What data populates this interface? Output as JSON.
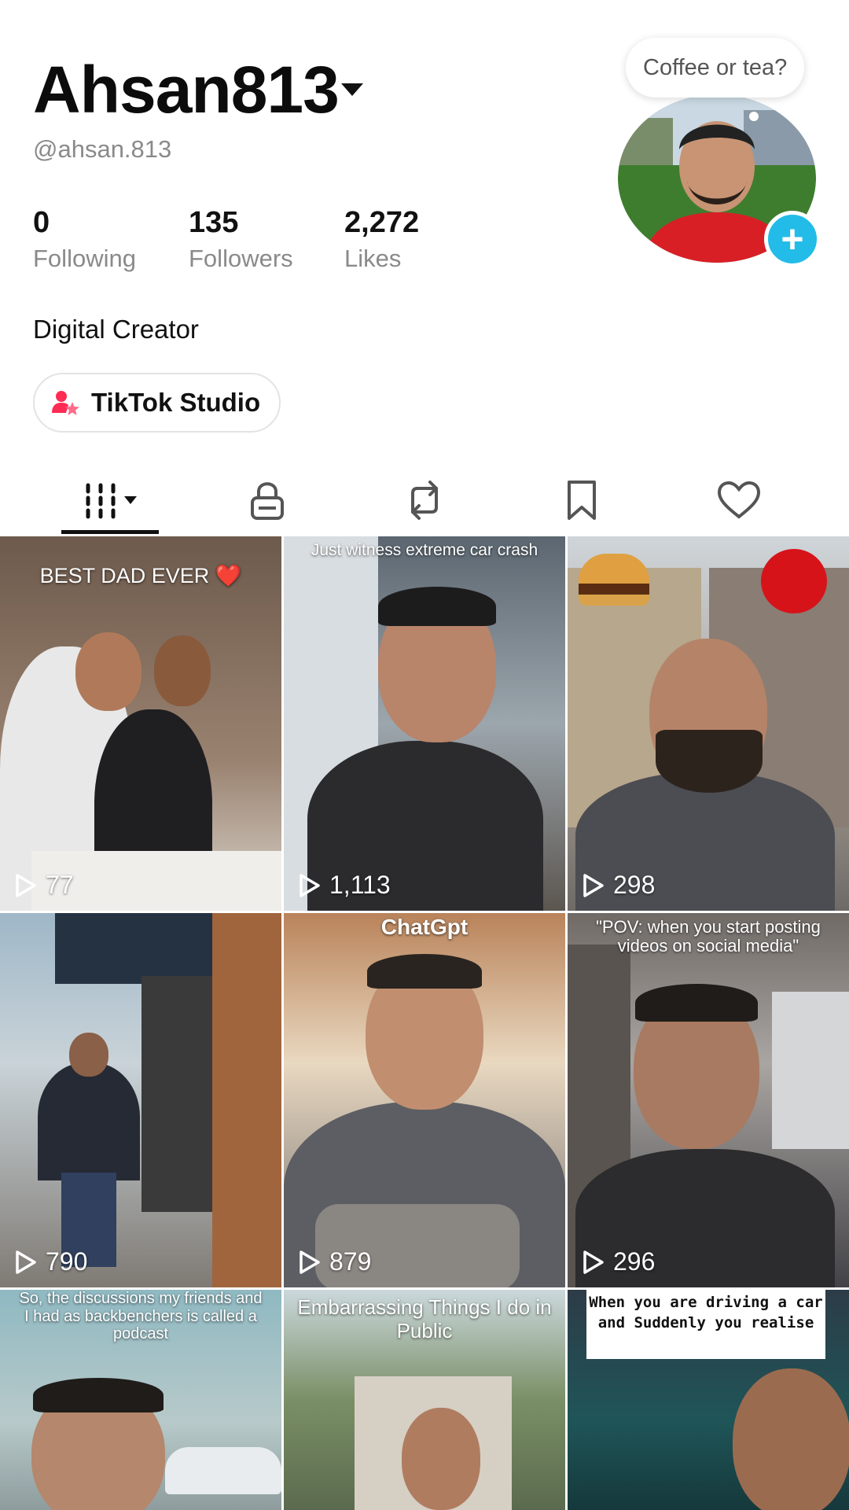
{
  "profile": {
    "display_name": "Ahsan813",
    "handle": "@ahsan.813",
    "bio": "Digital Creator",
    "status_bubble": "Coffee or tea?",
    "stats": [
      {
        "value": "0",
        "label": "Following"
      },
      {
        "value": "135",
        "label": "Followers"
      },
      {
        "value": "2,272",
        "label": "Likes"
      }
    ],
    "studio_button": "TikTok Studio"
  },
  "tabs": [
    {
      "name": "videos",
      "icon": "grid-icon",
      "active": true
    },
    {
      "name": "private",
      "icon": "lock-icon"
    },
    {
      "name": "reposts",
      "icon": "repost-icon"
    },
    {
      "name": "favorites",
      "icon": "bookmark-icon"
    },
    {
      "name": "liked",
      "icon": "heart-icon"
    }
  ],
  "videos": [
    {
      "caption": "BEST DAD EVER ❤️",
      "views": "77"
    },
    {
      "caption": "Just witness extreme car crash",
      "views": "1,113"
    },
    {
      "caption": "",
      "views": "298"
    },
    {
      "caption": "",
      "views": "790"
    },
    {
      "caption": "ChatGpt",
      "views": "879"
    },
    {
      "caption": "\"POV: when you start posting videos on social media\"",
      "views": "296"
    },
    {
      "caption": "So, the discussions my friends and I had as backbenchers is called a podcast",
      "views": ""
    },
    {
      "caption": "Embarrassing Things I do in Public",
      "views": ""
    },
    {
      "caption": "When you are driving a car and Suddenly you realise",
      "views": ""
    }
  ],
  "colors": {
    "accent_blue": "#23bce8",
    "secondary_text": "#8a8a8a",
    "studio_icon_pink": "#fe2c55"
  }
}
